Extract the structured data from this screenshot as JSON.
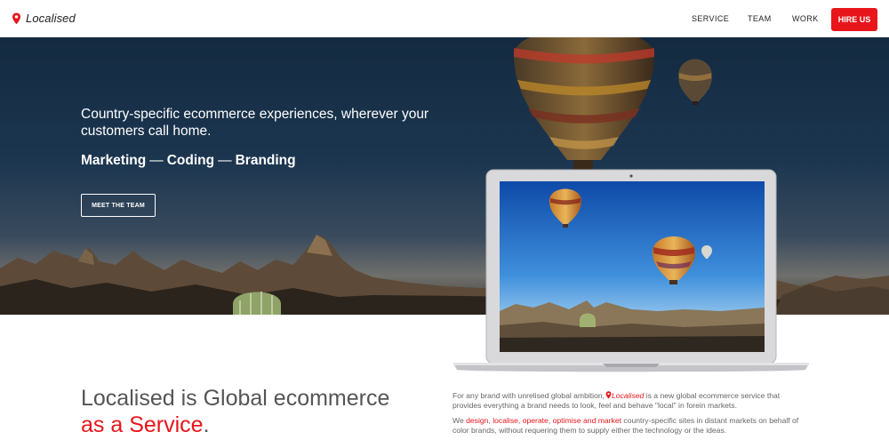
{
  "nav": {
    "brand_name": "Localised",
    "links": [
      "SERVICE",
      "TEAM",
      "WORK"
    ],
    "hire_label": "HIRE US"
  },
  "hero": {
    "headline": "Country-specific ecommerce experiences, wherever your customers call home.",
    "services": [
      "Marketing",
      "Coding",
      "Branding"
    ],
    "separator": "—",
    "cta_label": "MEET THE TEAM"
  },
  "about": {
    "title_part1": "Localised is Global ecommerce",
    "title_part2": "as a Service",
    "title_period": ".",
    "p1_before": "For any brand with unrelised global ambition,",
    "p1_brand": "Localised",
    "p1_after": " is a new global ecommerce service that provides everything a brand needs to look, feel and behave \"local\" in forein markets.",
    "p2_before": "We ",
    "p2_links": [
      "design",
      "localise",
      "operate",
      "optimise and market"
    ],
    "p2_after": " country-specific sites in distant markets on behalf of color brands, without requering them to supply either the technology or the ideas."
  },
  "colors": {
    "accent": "#e8151b",
    "text_dark": "#222222",
    "text_muted": "#666666"
  },
  "icons": {
    "brand": "map-pin-icon"
  }
}
